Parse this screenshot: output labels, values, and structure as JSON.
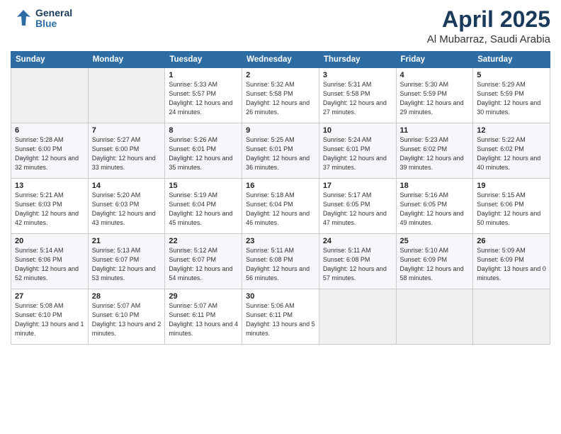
{
  "header": {
    "logo_line1": "General",
    "logo_line2": "Blue",
    "month_year": "April 2025",
    "location": "Al Mubarraz, Saudi Arabia"
  },
  "weekdays": [
    "Sunday",
    "Monday",
    "Tuesday",
    "Wednesday",
    "Thursday",
    "Friday",
    "Saturday"
  ],
  "weeks": [
    [
      {
        "day": null,
        "sunrise": null,
        "sunset": null,
        "daylight": null
      },
      {
        "day": null,
        "sunrise": null,
        "sunset": null,
        "daylight": null
      },
      {
        "day": "1",
        "sunrise": "Sunrise: 5:33 AM",
        "sunset": "Sunset: 5:57 PM",
        "daylight": "Daylight: 12 hours and 24 minutes."
      },
      {
        "day": "2",
        "sunrise": "Sunrise: 5:32 AM",
        "sunset": "Sunset: 5:58 PM",
        "daylight": "Daylight: 12 hours and 26 minutes."
      },
      {
        "day": "3",
        "sunrise": "Sunrise: 5:31 AM",
        "sunset": "Sunset: 5:58 PM",
        "daylight": "Daylight: 12 hours and 27 minutes."
      },
      {
        "day": "4",
        "sunrise": "Sunrise: 5:30 AM",
        "sunset": "Sunset: 5:59 PM",
        "daylight": "Daylight: 12 hours and 29 minutes."
      },
      {
        "day": "5",
        "sunrise": "Sunrise: 5:29 AM",
        "sunset": "Sunset: 5:59 PM",
        "daylight": "Daylight: 12 hours and 30 minutes."
      }
    ],
    [
      {
        "day": "6",
        "sunrise": "Sunrise: 5:28 AM",
        "sunset": "Sunset: 6:00 PM",
        "daylight": "Daylight: 12 hours and 32 minutes."
      },
      {
        "day": "7",
        "sunrise": "Sunrise: 5:27 AM",
        "sunset": "Sunset: 6:00 PM",
        "daylight": "Daylight: 12 hours and 33 minutes."
      },
      {
        "day": "8",
        "sunrise": "Sunrise: 5:26 AM",
        "sunset": "Sunset: 6:01 PM",
        "daylight": "Daylight: 12 hours and 35 minutes."
      },
      {
        "day": "9",
        "sunrise": "Sunrise: 5:25 AM",
        "sunset": "Sunset: 6:01 PM",
        "daylight": "Daylight: 12 hours and 36 minutes."
      },
      {
        "day": "10",
        "sunrise": "Sunrise: 5:24 AM",
        "sunset": "Sunset: 6:01 PM",
        "daylight": "Daylight: 12 hours and 37 minutes."
      },
      {
        "day": "11",
        "sunrise": "Sunrise: 5:23 AM",
        "sunset": "Sunset: 6:02 PM",
        "daylight": "Daylight: 12 hours and 39 minutes."
      },
      {
        "day": "12",
        "sunrise": "Sunrise: 5:22 AM",
        "sunset": "Sunset: 6:02 PM",
        "daylight": "Daylight: 12 hours and 40 minutes."
      }
    ],
    [
      {
        "day": "13",
        "sunrise": "Sunrise: 5:21 AM",
        "sunset": "Sunset: 6:03 PM",
        "daylight": "Daylight: 12 hours and 42 minutes."
      },
      {
        "day": "14",
        "sunrise": "Sunrise: 5:20 AM",
        "sunset": "Sunset: 6:03 PM",
        "daylight": "Daylight: 12 hours and 43 minutes."
      },
      {
        "day": "15",
        "sunrise": "Sunrise: 5:19 AM",
        "sunset": "Sunset: 6:04 PM",
        "daylight": "Daylight: 12 hours and 45 minutes."
      },
      {
        "day": "16",
        "sunrise": "Sunrise: 5:18 AM",
        "sunset": "Sunset: 6:04 PM",
        "daylight": "Daylight: 12 hours and 46 minutes."
      },
      {
        "day": "17",
        "sunrise": "Sunrise: 5:17 AM",
        "sunset": "Sunset: 6:05 PM",
        "daylight": "Daylight: 12 hours and 47 minutes."
      },
      {
        "day": "18",
        "sunrise": "Sunrise: 5:16 AM",
        "sunset": "Sunset: 6:05 PM",
        "daylight": "Daylight: 12 hours and 49 minutes."
      },
      {
        "day": "19",
        "sunrise": "Sunrise: 5:15 AM",
        "sunset": "Sunset: 6:06 PM",
        "daylight": "Daylight: 12 hours and 50 minutes."
      }
    ],
    [
      {
        "day": "20",
        "sunrise": "Sunrise: 5:14 AM",
        "sunset": "Sunset: 6:06 PM",
        "daylight": "Daylight: 12 hours and 52 minutes."
      },
      {
        "day": "21",
        "sunrise": "Sunrise: 5:13 AM",
        "sunset": "Sunset: 6:07 PM",
        "daylight": "Daylight: 12 hours and 53 minutes."
      },
      {
        "day": "22",
        "sunrise": "Sunrise: 5:12 AM",
        "sunset": "Sunset: 6:07 PM",
        "daylight": "Daylight: 12 hours and 54 minutes."
      },
      {
        "day": "23",
        "sunrise": "Sunrise: 5:11 AM",
        "sunset": "Sunset: 6:08 PM",
        "daylight": "Daylight: 12 hours and 56 minutes."
      },
      {
        "day": "24",
        "sunrise": "Sunrise: 5:11 AM",
        "sunset": "Sunset: 6:08 PM",
        "daylight": "Daylight: 12 hours and 57 minutes."
      },
      {
        "day": "25",
        "sunrise": "Sunrise: 5:10 AM",
        "sunset": "Sunset: 6:09 PM",
        "daylight": "Daylight: 12 hours and 58 minutes."
      },
      {
        "day": "26",
        "sunrise": "Sunrise: 5:09 AM",
        "sunset": "Sunset: 6:09 PM",
        "daylight": "Daylight: 13 hours and 0 minutes."
      }
    ],
    [
      {
        "day": "27",
        "sunrise": "Sunrise: 5:08 AM",
        "sunset": "Sunset: 6:10 PM",
        "daylight": "Daylight: 13 hours and 1 minute."
      },
      {
        "day": "28",
        "sunrise": "Sunrise: 5:07 AM",
        "sunset": "Sunset: 6:10 PM",
        "daylight": "Daylight: 13 hours and 2 minutes."
      },
      {
        "day": "29",
        "sunrise": "Sunrise: 5:07 AM",
        "sunset": "Sunset: 6:11 PM",
        "daylight": "Daylight: 13 hours and 4 minutes."
      },
      {
        "day": "30",
        "sunrise": "Sunrise: 5:06 AM",
        "sunset": "Sunset: 6:11 PM",
        "daylight": "Daylight: 13 hours and 5 minutes."
      },
      {
        "day": null,
        "sunrise": null,
        "sunset": null,
        "daylight": null
      },
      {
        "day": null,
        "sunrise": null,
        "sunset": null,
        "daylight": null
      },
      {
        "day": null,
        "sunrise": null,
        "sunset": null,
        "daylight": null
      }
    ]
  ]
}
